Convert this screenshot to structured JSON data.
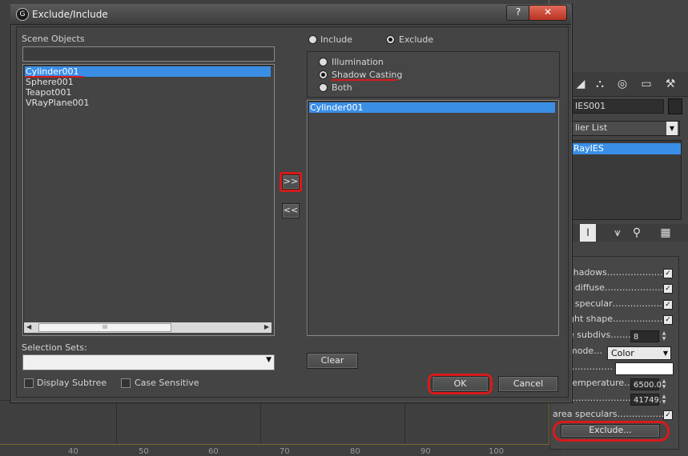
{
  "dialog": {
    "title": "Exclude/Include",
    "app_icon_glyph": "G",
    "win_help": "?",
    "win_close": "✕",
    "scene_objects_label": "Scene Objects",
    "scene_objects": [
      "Cylinder001",
      "Sphere001",
      "Teapot001",
      "VRayPlane001"
    ],
    "scene_selected": "Cylinder001",
    "mode_include_label": "Include",
    "mode_exclude_label": "Exclude",
    "mode_selected": "Exclude",
    "type_illumination_label": "Illumination",
    "type_shadow_label": "Shadow Casting",
    "type_both_label": "Both",
    "type_selected": "Shadow Casting",
    "excluded_objects": [
      "Cylinder001"
    ],
    "move_right_label": ">>",
    "move_left_label": "<<",
    "selection_sets_label": "Selection Sets:",
    "display_subtree_label": "Display Subtree",
    "case_sensitive_label": "Case Sensitive",
    "clear_label": "Clear",
    "ok_label": "OK",
    "cancel_label": "Cancel",
    "scroll_left": "◀",
    "scroll_right": "▶",
    "scroll_thumb_grip": "III",
    "dropdown_arrow": "▼"
  },
  "command_panel": {
    "name_field": "IES001",
    "modifier_list_label": "lier List",
    "modifier_stack_item": "RayIES",
    "params": [
      {
        "label": "shadows……………………",
        "checked": true
      },
      {
        "label": "t diffuse……………………",
        "checked": true
      },
      {
        "label": "t specular…………………",
        "checked": true
      },
      {
        "label": "ght shape…………………",
        "checked": true
      },
      {
        "label": "e subdivs……………",
        "value": "8"
      },
      {
        "label": "mode…",
        "select": "Color"
      },
      {
        "label": "……………",
        "color_swatch": "#ffffff"
      },
      {
        "label": "temperature…",
        "value": "6500.0"
      },
      {
        "label": "r……………………",
        "value": "41749."
      },
      {
        "label": "area speculars………………",
        "checked": true
      }
    ],
    "exclude_button_label": "Exclude...",
    "check_mark": "✓"
  },
  "ruler": {
    "ticks": [
      "40",
      "50",
      "60",
      "70",
      "80",
      "90",
      "100"
    ]
  },
  "colors": {
    "selection": "#3a8ee6",
    "annotation_red": "#d81a1a",
    "dialog_bg": "#444444"
  }
}
